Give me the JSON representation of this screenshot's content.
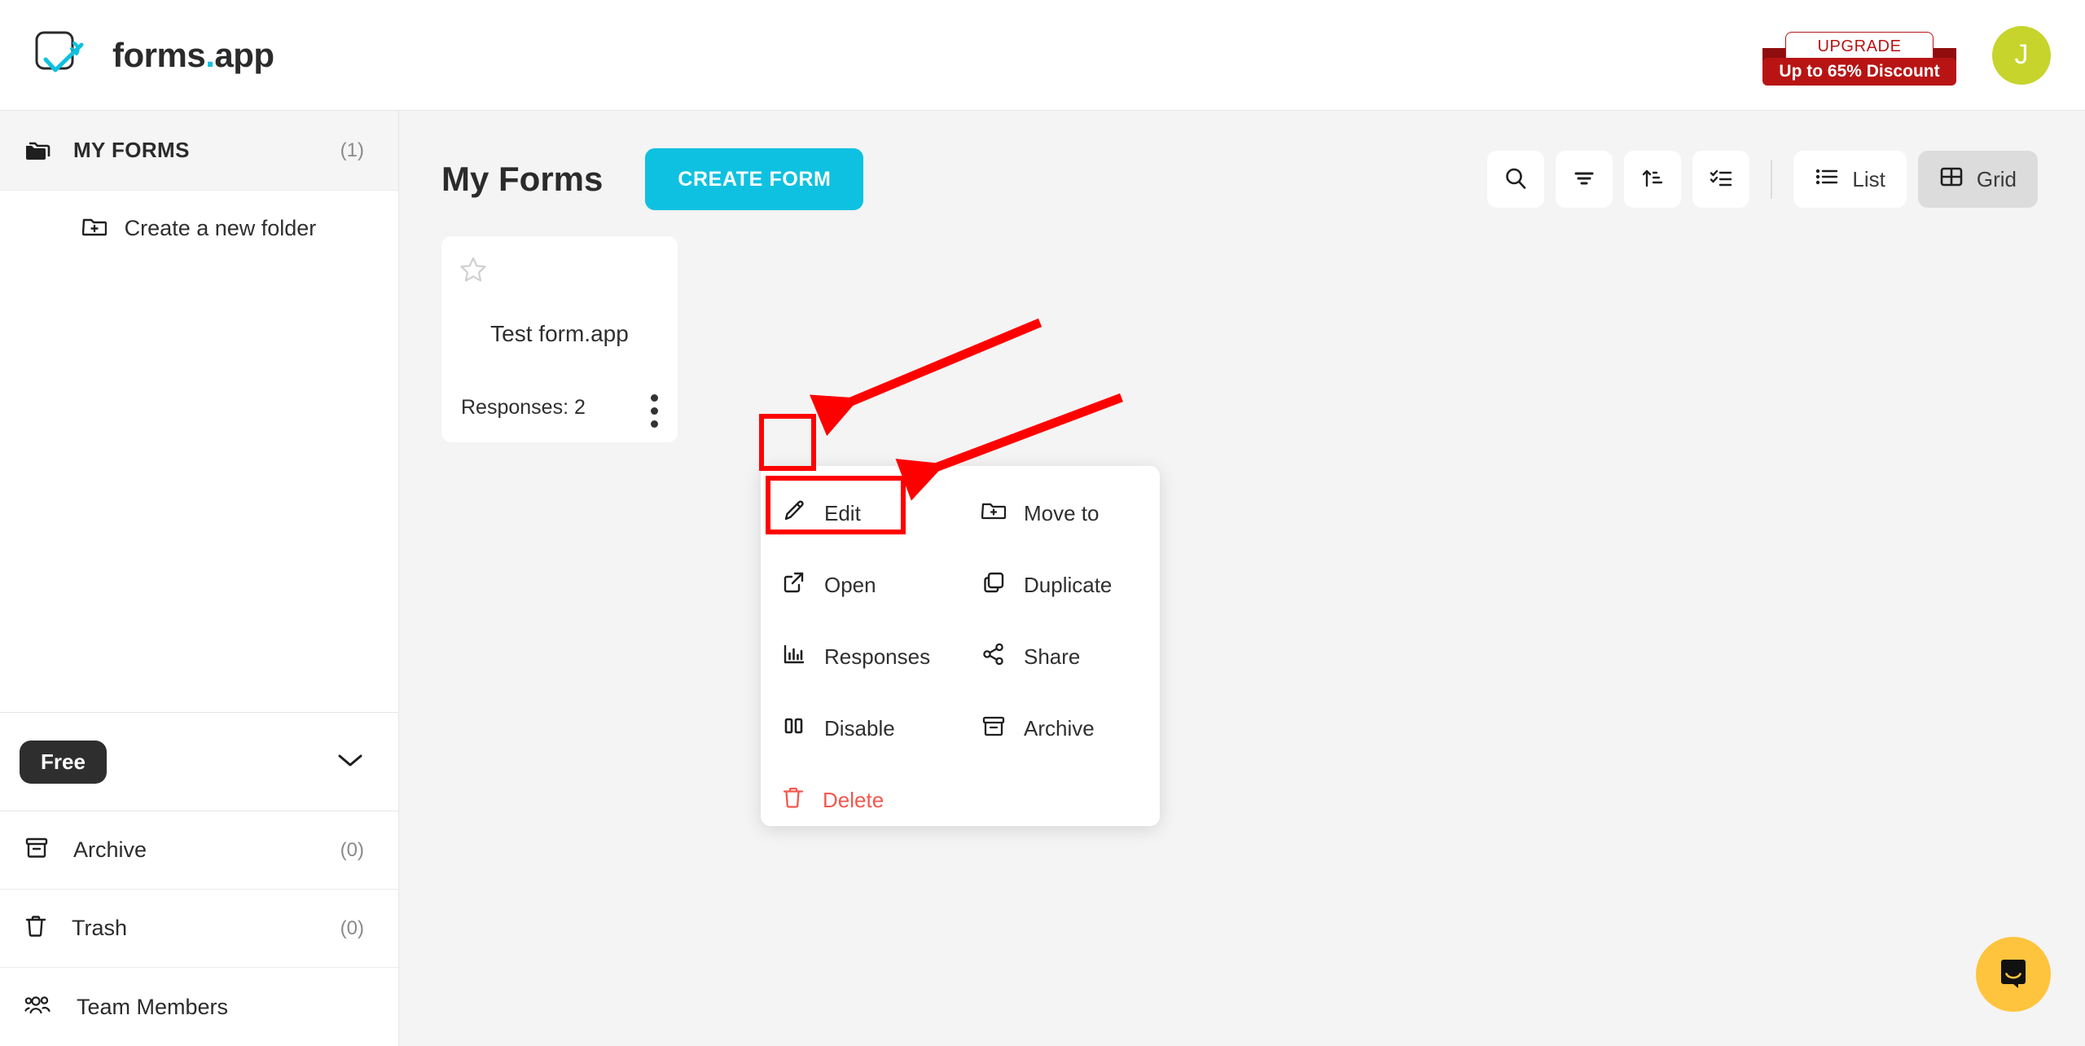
{
  "header": {
    "logo_text": "forms",
    "logo_dot": ".",
    "logo_suffix": "app",
    "logo_icon": "forms-app-check-logo",
    "upgrade": {
      "top_label": "UPGRADE",
      "bottom_label": "Up to 65% Discount"
    },
    "avatar_initial": "J"
  },
  "sidebar": {
    "my_forms_label": "MY FORMS",
    "my_forms_count": "(1)",
    "my_forms_icon": "folders-icon",
    "create_folder_label": "Create a new folder",
    "create_folder_icon": "folder-plus-icon",
    "plan_label": "Free",
    "plan_chevron_icon": "chevron-down-icon",
    "nav": [
      {
        "label": "Archive",
        "count": "(0)",
        "icon": "archive-box-icon"
      },
      {
        "label": "Trash",
        "count": "(0)",
        "icon": "trash-icon"
      },
      {
        "label": "Team Members",
        "count": "",
        "icon": "users-icon"
      }
    ]
  },
  "main": {
    "page_title": "My Forms",
    "create_form_label": "CREATE FORM",
    "toolbar": {
      "search_icon": "search-icon",
      "filter_icon": "filter-icon",
      "sort_icon": "sort-ascending-icon",
      "select_icon": "checklist-icon",
      "list_label": "List",
      "list_icon": "list-icon",
      "grid_label": "Grid",
      "grid_icon": "grid-icon",
      "active_view": "Grid"
    },
    "form_card": {
      "star_icon": "star-outline-icon",
      "title": "Test form.app",
      "responses_label": "Responses: 2",
      "kebab_icon": "three-dots-vertical-icon"
    }
  },
  "context_menu": {
    "items": [
      {
        "label": "Edit",
        "icon": "pencil-icon",
        "danger": false
      },
      {
        "label": "Move to",
        "icon": "folder-plus-icon",
        "danger": false
      },
      {
        "label": "Open",
        "icon": "external-link-icon",
        "danger": false
      },
      {
        "label": "Duplicate",
        "icon": "copy-icon",
        "danger": false
      },
      {
        "label": "Responses",
        "icon": "bar-chart-icon",
        "danger": false
      },
      {
        "label": "Share",
        "icon": "share-nodes-icon",
        "danger": false
      },
      {
        "label": "Disable",
        "icon": "pause-icon",
        "danger": false
      },
      {
        "label": "Archive",
        "icon": "archive-box-icon",
        "danger": false
      },
      {
        "label": "Delete",
        "icon": "trash-icon",
        "danger": true
      }
    ]
  },
  "chat": {
    "icon": "chat-bubble-icon"
  },
  "colors": {
    "accent_cyan": "#0fc1e0",
    "annotation_red": "#ff0000",
    "ribbon_red": "#b81414",
    "avatar_green": "#c6d42c",
    "delete_red": "#f2574e",
    "chat_yellow": "#ffc43d"
  }
}
